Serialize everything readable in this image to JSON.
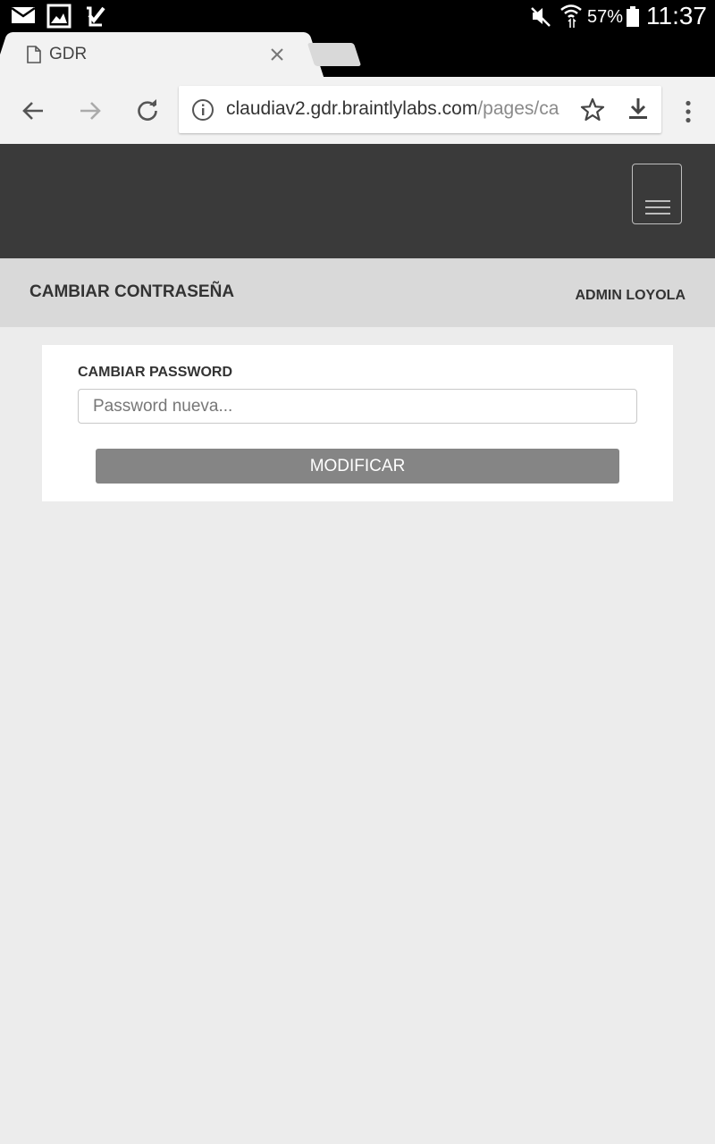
{
  "status_bar": {
    "battery_percent": "57%",
    "time": "11:37",
    "icons": [
      "email-icon",
      "gallery-icon",
      "task-check-icon",
      "mute-icon",
      "wifi-icon",
      "battery-icon"
    ]
  },
  "browser": {
    "tab_title": "GDR",
    "url_host": "claudiav2.gdr.braintlylabs.com",
    "url_path": "/pages/ca",
    "toolbar_icons": [
      "back-arrow-icon",
      "forward-arrow-icon",
      "reload-icon",
      "info-icon",
      "star-icon",
      "download-icon",
      "more-vert-icon"
    ]
  },
  "site": {
    "header_color": "#3a3a3a",
    "page_title": "CAMBIAR CONTRASEÑA",
    "user_name": "ADMIN LOYOLA"
  },
  "form": {
    "label": "CAMBIAR PASSWORD",
    "password_value": "",
    "password_placeholder": "Password nueva...",
    "submit_label": "MODIFICAR",
    "submit_color": "#858585"
  }
}
